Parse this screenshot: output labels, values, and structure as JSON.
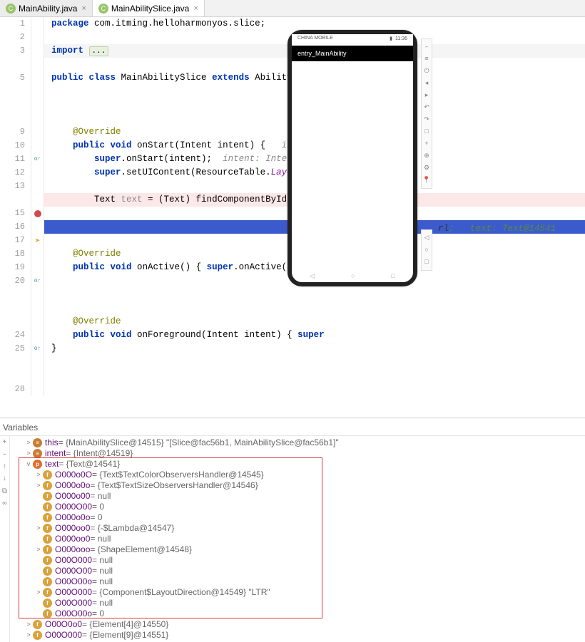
{
  "tabs": [
    {
      "label": "MainAbility.java",
      "icon": "C"
    },
    {
      "label": "MainAbilitySlice.java",
      "icon": "C"
    }
  ],
  "code": {
    "l1_package": "package",
    "l1_pkg": "com.itming.helloharmonyos.slice",
    "l3_import": "import",
    "l3_dots": "...",
    "l5_p1": "public class",
    "l5_name": "MainAbilitySlice",
    "l5_ext": "extends",
    "l5_sup": "AbilitySlice",
    "l9_ann": "@Override",
    "l10_p": "public void",
    "l10_m": "onStart",
    "l10_args": "(Intent intent) {",
    "l10_c": "intent:",
    "l12_s": "super",
    "l12_m": ".onStart(intent);",
    "l12_c": "intent: Intent@145",
    "l13_s": "super",
    "l13_m": ".setUIContent(ResourceTable.",
    "l13_p": "Layout_ab",
    "l15_t": "Text ",
    "l15_v": "text",
    "l15_mid": " = (Text) findComponentById(Reso",
    "l15_rl": "rl",
    "l15_right": "text: Text@14541",
    "l19_ann": "@Override",
    "l20_p": "public void",
    "l20_m": "onActive",
    "l20_body": "() { ",
    "l20_s": "super",
    "l20_rest": ".onActive(); }",
    "l24_ann": "@Override",
    "l25_p": "public void",
    "l25_m": "onForeground",
    "l25_args": "(Intent intent) { ",
    "l25_s": "super"
  },
  "device": {
    "carrier": "CHINA MOBILE",
    "time": "11:36",
    "title": "entry_MainAbility"
  },
  "variables": {
    "title": "Variables",
    "rows": [
      {
        "ind": 1,
        "arr": ">",
        "b": "be",
        "bl": "≡",
        "name": "this",
        "val": " = {MainAbilitySlice@14515} \"[Slice@fac56b1, MainAbilitySlice@fac56b1]\""
      },
      {
        "ind": 1,
        "arr": ">",
        "b": "be",
        "bl": "≡",
        "name": "intent",
        "val": " = {Intent@14519}"
      },
      {
        "ind": 1,
        "arr": "v",
        "b": "bp",
        "bl": "p",
        "name": "text",
        "val": " = {Text@14541}"
      },
      {
        "ind": 2,
        "arr": ">",
        "b": "bf",
        "bl": "f",
        "name": "O000o0O",
        "val": " = {Text$TextColorObserversHandler@14545}"
      },
      {
        "ind": 2,
        "arr": ">",
        "b": "bf",
        "bl": "f",
        "name": "O000o0o",
        "val": " = {Text$TextSizeObserversHandler@14546}"
      },
      {
        "ind": 2,
        "arr": "",
        "b": "bf",
        "bl": "f",
        "name": "O000o00",
        "val": " = null"
      },
      {
        "ind": 2,
        "arr": "",
        "b": "bf",
        "bl": "f",
        "name": "O000O00",
        "val": " = 0"
      },
      {
        "ind": 2,
        "arr": "",
        "b": "bf",
        "bl": "f",
        "name": "O000o0o",
        "val": " = 0"
      },
      {
        "ind": 2,
        "arr": ">",
        "b": "bf",
        "bl": "f",
        "name": "O000oo0",
        "val": " = {-$Lambda@14547}"
      },
      {
        "ind": 2,
        "arr": "",
        "b": "bf",
        "bl": "f",
        "name": "O000oo0",
        "val": " = null"
      },
      {
        "ind": 2,
        "arr": ">",
        "b": "bf",
        "bl": "f",
        "name": "O000ooo",
        "val": " = {ShapeElement@14548}"
      },
      {
        "ind": 2,
        "arr": "",
        "b": "bf",
        "bl": "f",
        "name": "O00O000",
        "val": " = null"
      },
      {
        "ind": 2,
        "arr": "",
        "b": "bf",
        "bl": "f",
        "name": "O000O00",
        "val": " = null"
      },
      {
        "ind": 2,
        "arr": "",
        "b": "bf",
        "bl": "f",
        "name": "O00O00o",
        "val": " = null"
      },
      {
        "ind": 2,
        "arr": ">",
        "b": "bf",
        "bl": "f",
        "name": "O00O000",
        "val": " = {Component$LayoutDirection@14549} \"LTR\""
      },
      {
        "ind": 2,
        "arr": "",
        "b": "bf",
        "bl": "f",
        "name": "O00O000",
        "val": " = null"
      },
      {
        "ind": 2,
        "arr": "",
        "b": "bf",
        "bl": "f",
        "name": "O00O00o",
        "val": " = 0"
      },
      {
        "ind": 1,
        "arr": ">",
        "b": "bf",
        "bl": "f",
        "name": "O00O0o0",
        "val": " = {Element[4]@14550}"
      },
      {
        "ind": 1,
        "arr": ">",
        "b": "bf",
        "bl": "f",
        "name": "O00O000",
        "val": " = {Element[9]@14551}"
      }
    ]
  },
  "gutterLines": [
    "1",
    "2",
    "3",
    "",
    "5",
    "",
    "",
    "",
    "9",
    "10",
    "11",
    "12",
    "13",
    "",
    "15",
    "16",
    "17",
    "18",
    "19",
    "20",
    "",
    "",
    "",
    "24",
    "25",
    "",
    "",
    "28"
  ]
}
